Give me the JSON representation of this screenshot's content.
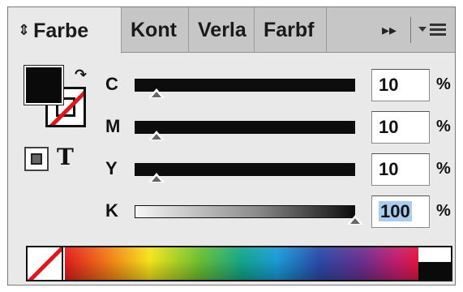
{
  "tabs": [
    {
      "label": "Farbe",
      "active": true
    },
    {
      "label": "Kont",
      "active": false
    },
    {
      "label": "Verla",
      "active": false
    },
    {
      "label": "Farbf",
      "active": false
    }
  ],
  "tab_chevron": "⇕",
  "overflow_icon": "▸▸",
  "swap_icon": "↷",
  "text_icon_glyph": "T",
  "channels": [
    {
      "label": "C",
      "value": "10",
      "fraction": 0.1,
      "unit": "%"
    },
    {
      "label": "M",
      "value": "10",
      "fraction": 0.1,
      "unit": "%"
    },
    {
      "label": "Y",
      "value": "10",
      "fraction": 0.1,
      "unit": "%"
    },
    {
      "label": "K",
      "value": "100",
      "fraction": 1.0,
      "unit": "%",
      "selected": true
    }
  ],
  "icons": [
    "chevron-updown-icon",
    "fast-forward-icon",
    "panel-menu-icon",
    "swap-arrow-icon",
    "container-format-icon",
    "text-format-icon",
    "none-swatch-icon"
  ],
  "colors": {
    "fill": "#0a0a0a",
    "none_slash": "#e0161b",
    "selection": "#a9cdee"
  }
}
